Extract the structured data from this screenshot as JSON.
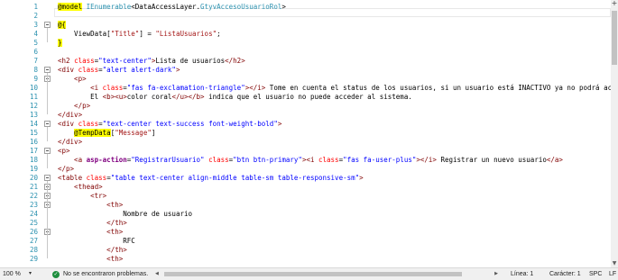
{
  "editor": {
    "line_numbers": [
      "1",
      "2",
      "3",
      "4",
      "5",
      "6",
      "7",
      "8",
      "9",
      "10",
      "11",
      "12",
      "13",
      "14",
      "15",
      "16",
      "17",
      "18",
      "19",
      "20",
      "21",
      "22",
      "23",
      "24",
      "25",
      "26",
      "27",
      "28",
      "29"
    ],
    "lines": [
      [
        {
          "t": "@model",
          "c": "t-razor"
        },
        {
          "t": " ",
          "c": "t-txt"
        },
        {
          "t": "IEnumerable",
          "c": "t-type"
        },
        {
          "t": "<DataAccessLayer.",
          "c": "t-txt"
        },
        {
          "t": "GtyvAccesoUsuarioRol",
          "c": "t-type"
        },
        {
          "t": ">",
          "c": "t-txt"
        }
      ],
      [],
      [
        {
          "t": "@{",
          "c": "t-razor"
        }
      ],
      [
        {
          "t": "    ViewData[",
          "c": "t-txt"
        },
        {
          "t": "\"Title\"",
          "c": "t-str"
        },
        {
          "t": "] = ",
          "c": "t-txt"
        },
        {
          "t": "\"ListaUsuarios\"",
          "c": "t-str"
        },
        {
          "t": ";",
          "c": "t-txt"
        }
      ],
      [
        {
          "t": "}",
          "c": "t-razor"
        }
      ],
      [],
      [
        {
          "t": "<h2 ",
          "c": "t-tag"
        },
        {
          "t": "class",
          "c": "t-attr"
        },
        {
          "t": "=",
          "c": "t-txt"
        },
        {
          "t": "\"text-center\"",
          "c": "t-aval"
        },
        {
          "t": ">",
          "c": "t-tag"
        },
        {
          "t": "Lista de usuarios",
          "c": "t-txt"
        },
        {
          "t": "</h2>",
          "c": "t-tag"
        }
      ],
      [
        {
          "t": "<div ",
          "c": "t-tag"
        },
        {
          "t": "class",
          "c": "t-attr"
        },
        {
          "t": "=",
          "c": "t-txt"
        },
        {
          "t": "\"alert alert-dark\"",
          "c": "t-aval"
        },
        {
          "t": ">",
          "c": "t-tag"
        }
      ],
      [
        {
          "t": "    <p>",
          "c": "t-tag"
        }
      ],
      [
        {
          "t": "        <i ",
          "c": "t-tag"
        },
        {
          "t": "class",
          "c": "t-attr"
        },
        {
          "t": "=",
          "c": "t-txt"
        },
        {
          "t": "\"fas fa-exclamation-triangle\"",
          "c": "t-aval"
        },
        {
          "t": "></i>",
          "c": "t-tag"
        },
        {
          "t": " Tome en cuenta el status de los usuarios, si un usuario está INACTIVO ya no podrá acceder a",
          "c": "t-txt"
        }
      ],
      [
        {
          "t": "        El ",
          "c": "t-txt"
        },
        {
          "t": "<b><u>",
          "c": "t-tag"
        },
        {
          "t": "color coral",
          "c": "t-txt"
        },
        {
          "t": "</u></b>",
          "c": "t-tag"
        },
        {
          "t": " indica que el usuario no puede acceder al sistema.",
          "c": "t-txt"
        }
      ],
      [
        {
          "t": "    </p>",
          "c": "t-tag"
        }
      ],
      [
        {
          "t": "</div>",
          "c": "t-tag"
        }
      ],
      [
        {
          "t": "<div ",
          "c": "t-tag"
        },
        {
          "t": "class",
          "c": "t-attr"
        },
        {
          "t": "=",
          "c": "t-txt"
        },
        {
          "t": "\"text-center text-success font-weight-bold\"",
          "c": "t-aval"
        },
        {
          "t": ">",
          "c": "t-tag"
        }
      ],
      [
        {
          "t": "    ",
          "c": "t-txt"
        },
        {
          "t": "@TempData",
          "c": "t-razor"
        },
        {
          "t": "[",
          "c": "t-txt"
        },
        {
          "t": "\"Message\"",
          "c": "t-str"
        },
        {
          "t": "]",
          "c": "t-txt"
        }
      ],
      [
        {
          "t": "</div>",
          "c": "t-tag"
        }
      ],
      [
        {
          "t": "<p>",
          "c": "t-tag"
        }
      ],
      [
        {
          "t": "    <a ",
          "c": "t-tag"
        },
        {
          "t": "asp-action",
          "c": "t-asp"
        },
        {
          "t": "=",
          "c": "t-txt"
        },
        {
          "t": "\"RegistrarUsuario\"",
          "c": "t-aval"
        },
        {
          "t": " ",
          "c": "t-txt"
        },
        {
          "t": "class",
          "c": "t-attr"
        },
        {
          "t": "=",
          "c": "t-txt"
        },
        {
          "t": "\"btn btn-primary\"",
          "c": "t-aval"
        },
        {
          "t": "><i ",
          "c": "t-tag"
        },
        {
          "t": "class",
          "c": "t-attr"
        },
        {
          "t": "=",
          "c": "t-txt"
        },
        {
          "t": "\"fas fa-user-plus\"",
          "c": "t-aval"
        },
        {
          "t": "></i>",
          "c": "t-tag"
        },
        {
          "t": " Registrar un nuevo usuario",
          "c": "t-txt"
        },
        {
          "t": "</a>",
          "c": "t-tag"
        }
      ],
      [
        {
          "t": "</p>",
          "c": "t-tag"
        }
      ],
      [
        {
          "t": "<table ",
          "c": "t-tag"
        },
        {
          "t": "class",
          "c": "t-attr"
        },
        {
          "t": "=",
          "c": "t-txt"
        },
        {
          "t": "\"table text-center align-middle table-sm table-responsive-sm\"",
          "c": "t-aval"
        },
        {
          "t": ">",
          "c": "t-tag"
        }
      ],
      [
        {
          "t": "    <thead>",
          "c": "t-tag"
        }
      ],
      [
        {
          "t": "        <tr>",
          "c": "t-tag"
        }
      ],
      [
        {
          "t": "            <th>",
          "c": "t-tag"
        }
      ],
      [
        {
          "t": "                Nombre de usuario",
          "c": "t-txt"
        }
      ],
      [
        {
          "t": "            </th>",
          "c": "t-tag"
        }
      ],
      [
        {
          "t": "            <th>",
          "c": "t-tag"
        }
      ],
      [
        {
          "t": "                RFC",
          "c": "t-txt"
        }
      ],
      [
        {
          "t": "            </th>",
          "c": "t-tag"
        }
      ],
      [
        {
          "t": "            <th>",
          "c": "t-tag"
        }
      ]
    ]
  },
  "statusbar": {
    "zoom": "100 %",
    "zoom_caret": "▾",
    "problems": "No se encontraron problemas.",
    "ok_glyph": "✓",
    "line": "Línea: 1",
    "column": "Carácter: 1",
    "spacing": "SPC",
    "line_ending": "LF"
  },
  "icons": {
    "split": "+",
    "up": "▲",
    "down": "▼",
    "left": "◀",
    "right": "▶"
  }
}
